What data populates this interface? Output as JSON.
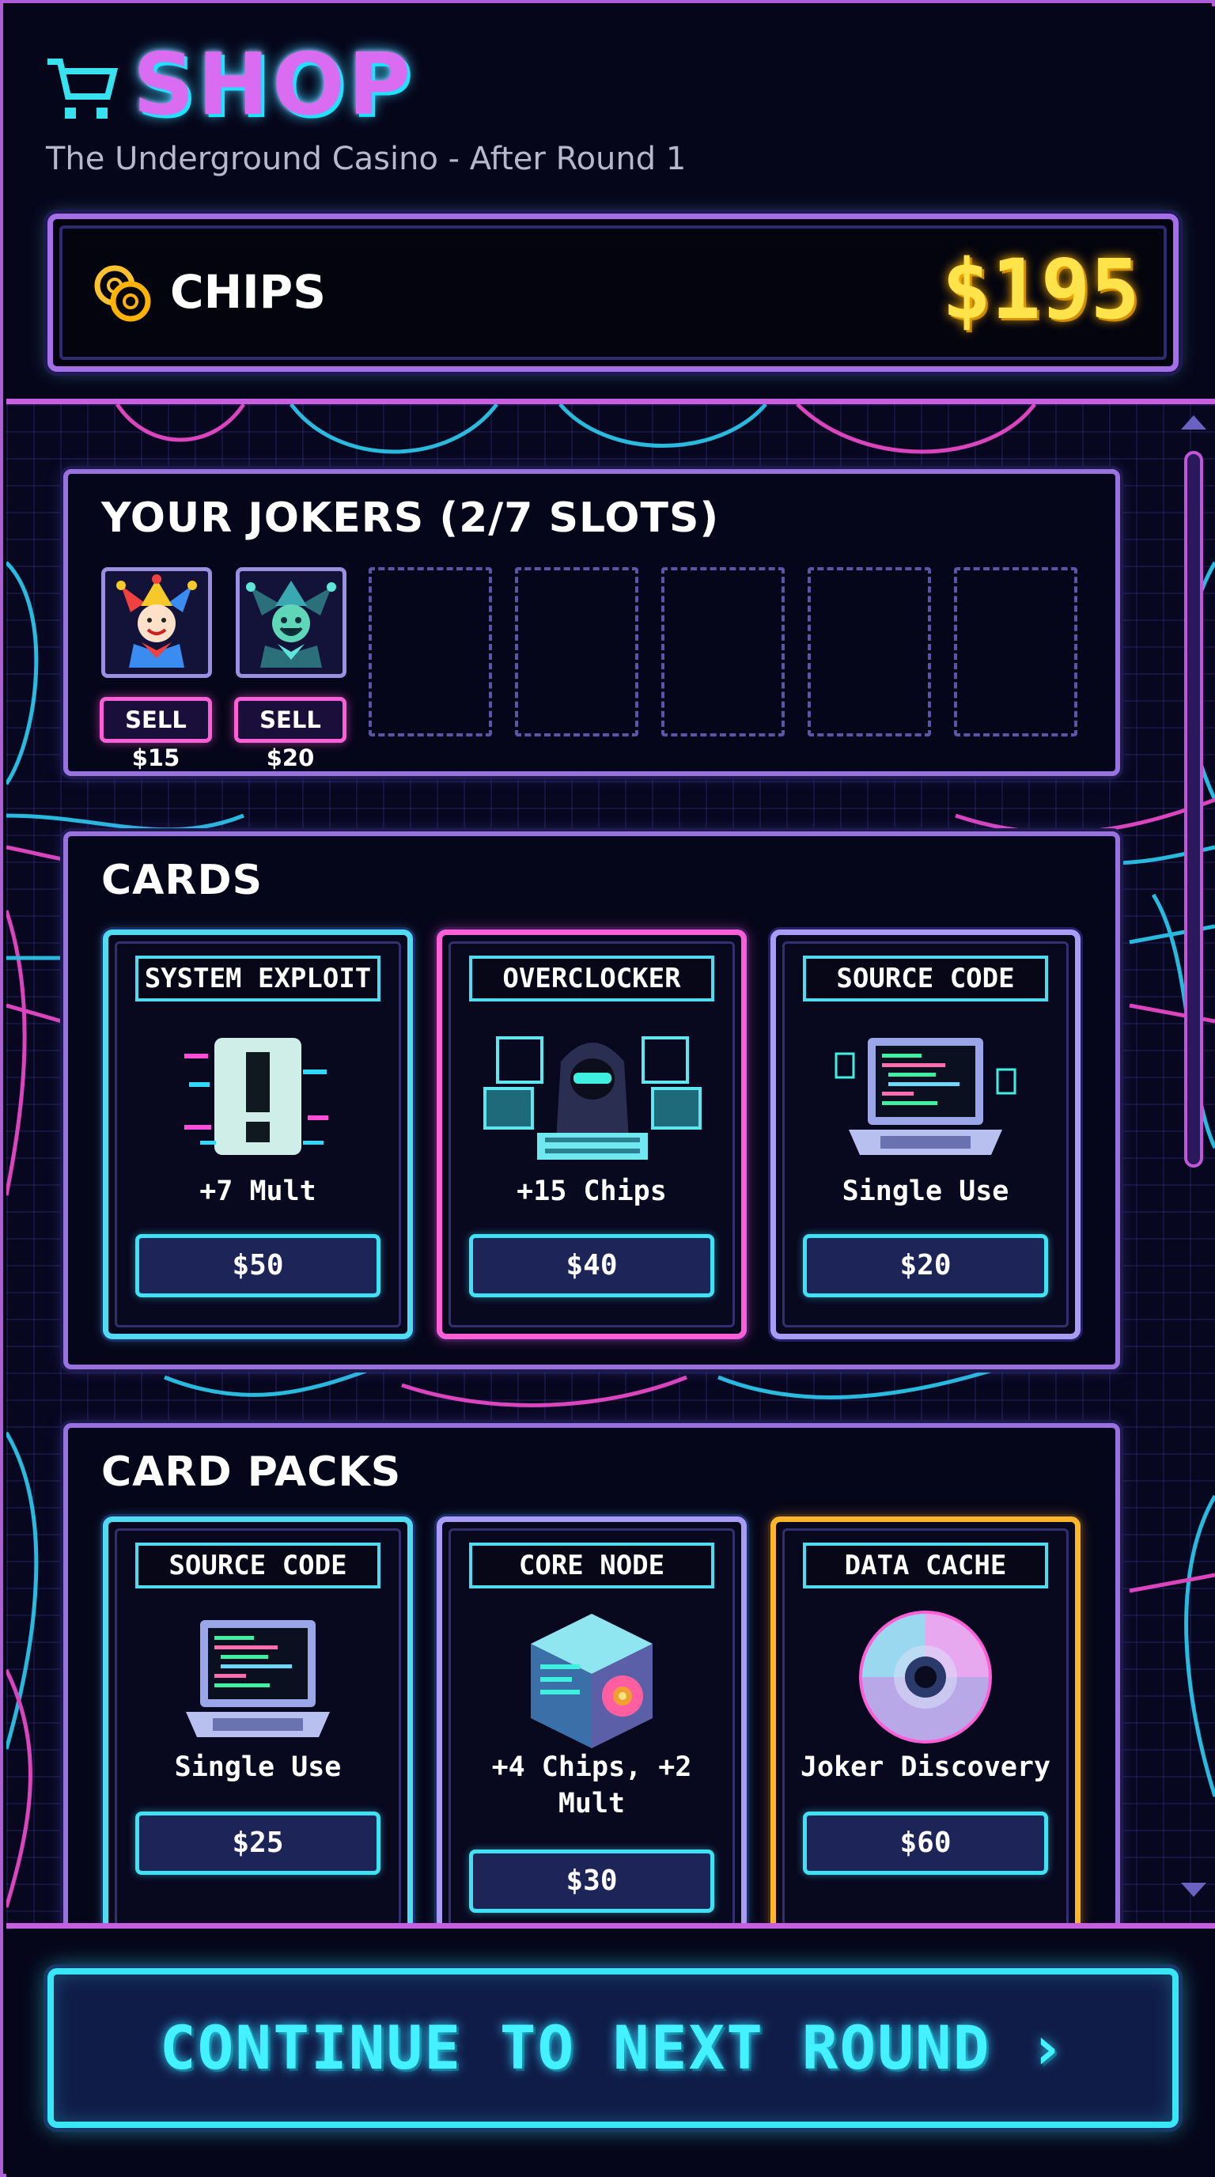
{
  "header": {
    "title": "SHOP",
    "subtitle": "The Underground Casino - After Round 1",
    "icon": "shopping-cart-icon"
  },
  "chips": {
    "label": "CHIPS",
    "value": "$195",
    "icon": "coin-stack-icon"
  },
  "jokers": {
    "title": "YOUR JOKERS (2/7 SLOTS)",
    "filled": 2,
    "total": 7,
    "items": [
      {
        "icon": "jester-joker-icon",
        "sell_label": "SELL $15"
      },
      {
        "icon": "teal-joker-icon",
        "sell_label": "SELL $20"
      }
    ]
  },
  "cards": {
    "title": "CARDS",
    "items": [
      {
        "name": "SYSTEM EXPLOIT",
        "icon": "glitch-exclamation-icon",
        "effect": "+7 Mult",
        "price": "$50",
        "accent": "#4fdcf0"
      },
      {
        "name": "OVERCLOCKER",
        "icon": "hooded-hacker-icon",
        "effect": "+15 Chips",
        "price": "$40",
        "accent": "#ff5fd6"
      },
      {
        "name": "SOURCE CODE",
        "icon": "laptop-code-icon",
        "effect": "Single Use",
        "price": "$20",
        "accent": "#a99cf4"
      }
    ]
  },
  "packs": {
    "title": "CARD PACKS",
    "items": [
      {
        "name": "SOURCE CODE",
        "icon": "laptop-code-icon",
        "effect": "Single Use",
        "price": "$25",
        "accent": "#4fdcf0"
      },
      {
        "name": "CORE NODE",
        "icon": "data-cube-icon",
        "effect_line1": "+4 Chips, +2",
        "effect_line2": "Mult",
        "price": "$30",
        "accent": "#a99cf4"
      },
      {
        "name": "DATA CACHE",
        "icon": "disc-icon",
        "effect": "Joker Discovery",
        "price": "$60",
        "accent": "#ffb52a"
      }
    ]
  },
  "footer": {
    "continue_label": "CONTINUE TO NEXT ROUND ›"
  },
  "colors": {
    "accent_cyan": "#39e6f6",
    "accent_pink": "#ff5fd6",
    "accent_purple": "#a56fe8",
    "chips_gold": "#ffe34a",
    "background": "#070718"
  }
}
